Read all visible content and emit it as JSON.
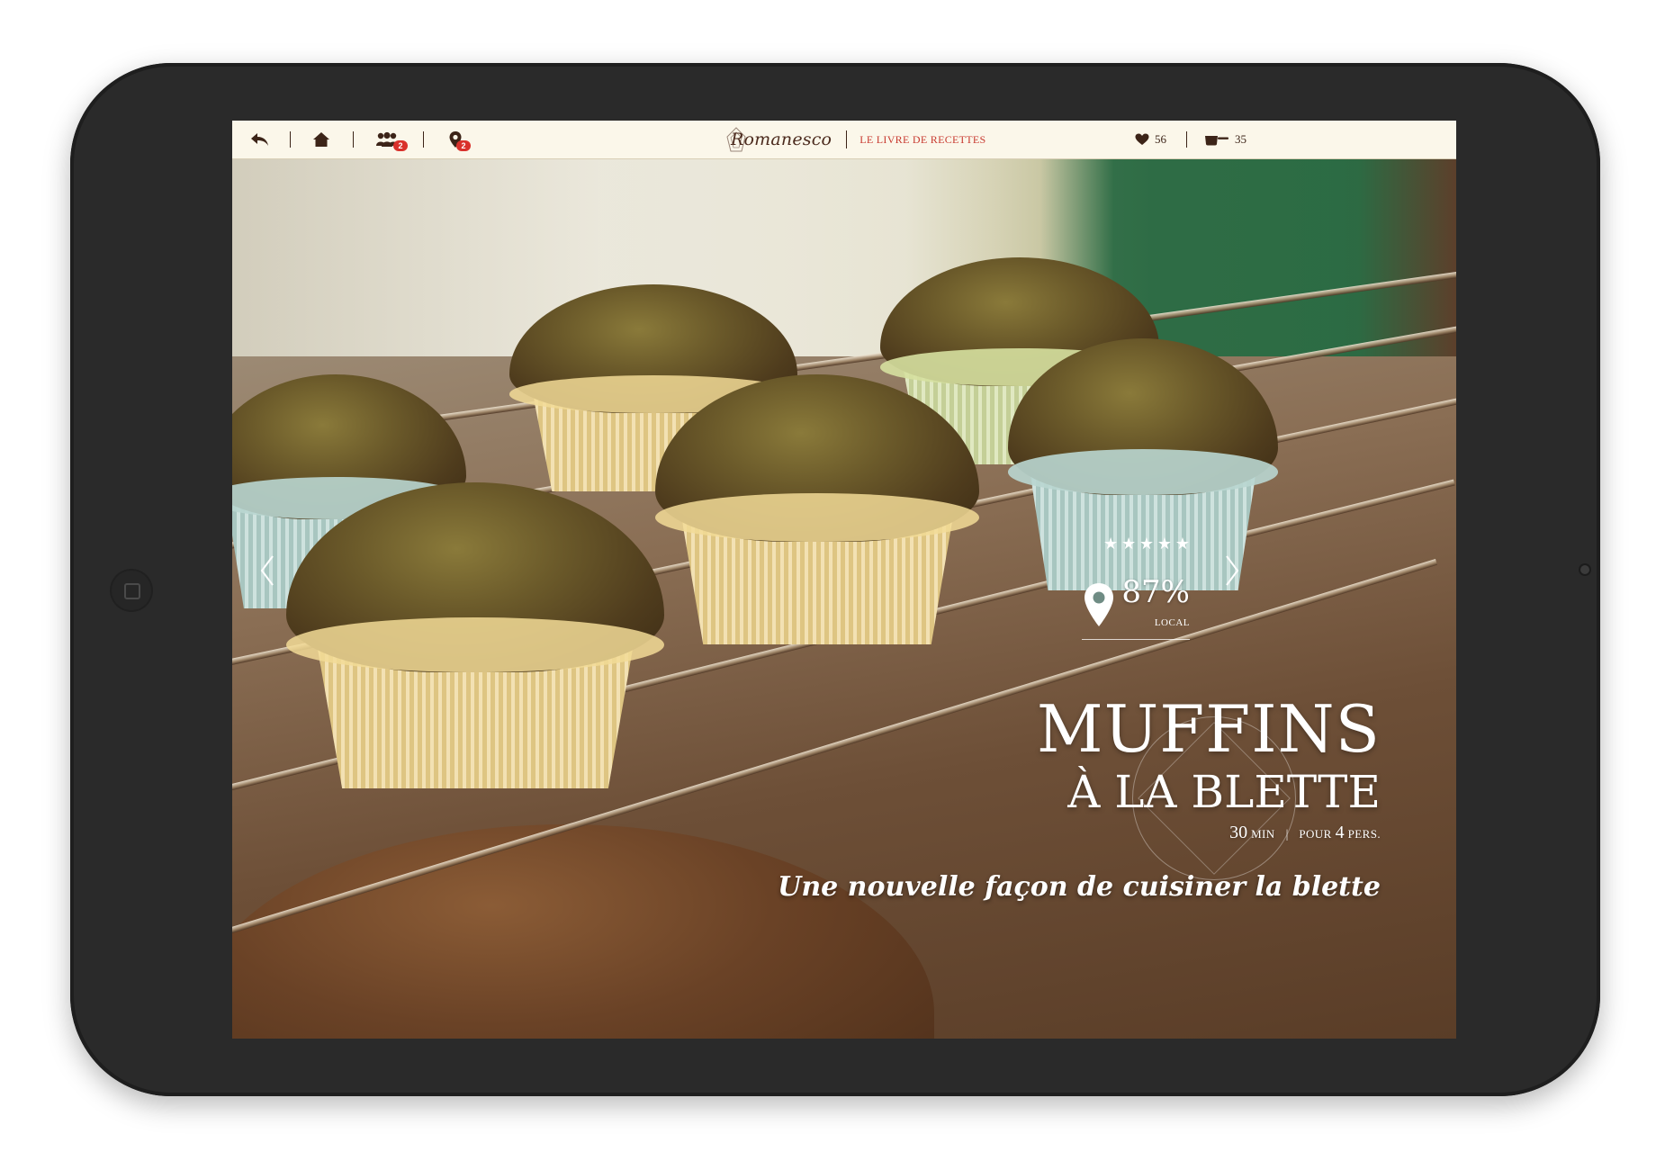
{
  "header": {
    "brand": "Romanesco",
    "section": "LE LIVRE DE RECETTES",
    "community_badge": "2",
    "location_badge": "2",
    "likes_count": "56",
    "cooked_count": "35"
  },
  "recipe": {
    "rating_stars": 5,
    "local_percent": "87%",
    "local_label": "LOCAL",
    "title_line1": "MUFFINS",
    "title_line2": "À LA BLETTE",
    "time_value": "30",
    "time_unit": "MIN",
    "separator": "|",
    "servings_prefix": "POUR",
    "servings_value": "4",
    "servings_unit": "PERS.",
    "tagline": "Une nouvelle façon de cuisiner la blette"
  },
  "icons": {
    "back": "back-arrow-icon",
    "home": "home-icon",
    "community": "people-icon",
    "location": "map-pin-icon",
    "likes": "heart-icon",
    "cooked": "pot-icon",
    "prev": "chevron-left-icon",
    "next": "chevron-right-icon",
    "star": "star-icon",
    "local": "location-pin-icon"
  },
  "colors": {
    "topbar_bg": "#fbf7ea",
    "brand_text": "#4b2a1d",
    "accent_red": "#c83a30",
    "badge_red": "#d9312b",
    "overlay_text": "#ffffff"
  }
}
